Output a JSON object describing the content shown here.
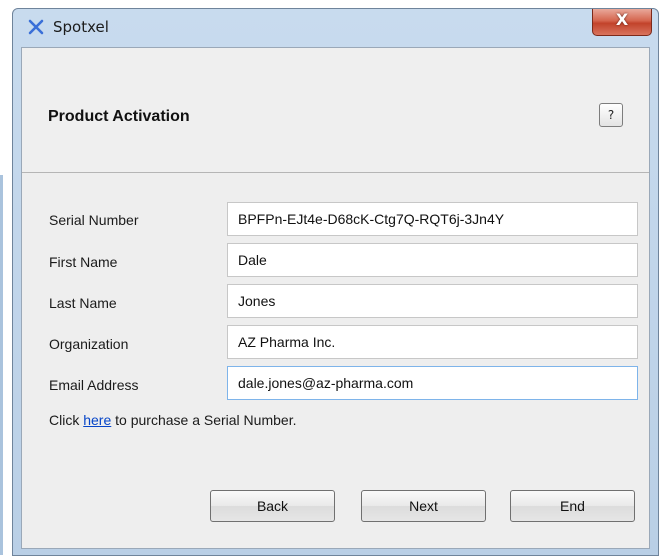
{
  "window": {
    "title": "Spotxel",
    "close_label": "X",
    "app_icon": "spotxel-x-icon"
  },
  "header": {
    "title": "Product Activation",
    "help_label": "?"
  },
  "form": {
    "serial": {
      "label": "Serial Number",
      "value": "BPFPn-EJt4e-D68cK-Ctg7Q-RQT6j-3Jn4Y"
    },
    "first_name": {
      "label": "First Name",
      "value": "Dale"
    },
    "last_name": {
      "label": "Last Name",
      "value": "Jones"
    },
    "organization": {
      "label": "Organization",
      "value": "AZ Pharma Inc."
    },
    "email": {
      "label": "Email Address",
      "value": "dale.jones@az-pharma.com"
    }
  },
  "purchase": {
    "prefix": "Click ",
    "link_text": "here",
    "suffix": " to purchase a Serial Number."
  },
  "buttons": {
    "back": "Back",
    "next": "Next",
    "end": "End"
  },
  "colors": {
    "link": "#0645c8",
    "close_button": "#c2432b",
    "app_icon": "#3a6fd8"
  }
}
